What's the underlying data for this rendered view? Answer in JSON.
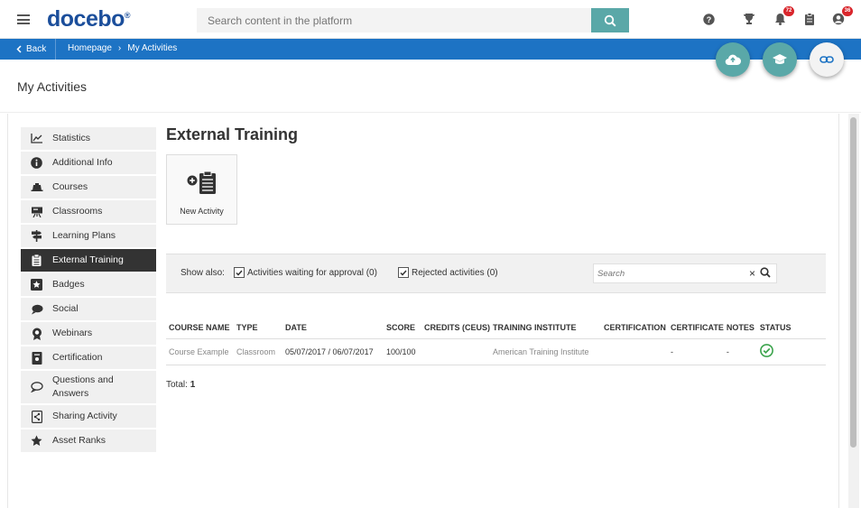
{
  "header": {
    "logo": "docebo",
    "logo_mark": "®",
    "search_placeholder": "Search content in the platform",
    "notifications_count": "72",
    "profile_count": "36"
  },
  "breadcrumb": {
    "back_label": "Back",
    "items": [
      "Homepage",
      "My Activities"
    ]
  },
  "page": {
    "title": "My Activities"
  },
  "sidebar": {
    "items": [
      {
        "label": "Statistics",
        "icon": "chart-icon"
      },
      {
        "label": "Additional Info",
        "icon": "info-icon"
      },
      {
        "label": "Courses",
        "icon": "courses-icon"
      },
      {
        "label": "Classrooms",
        "icon": "classroom-icon"
      },
      {
        "label": "Learning Plans",
        "icon": "signpost-icon"
      },
      {
        "label": "External Training",
        "icon": "clipboard-icon"
      },
      {
        "label": "Badges",
        "icon": "star-badge-icon"
      },
      {
        "label": "Social",
        "icon": "chat-icon"
      },
      {
        "label": "Webinars",
        "icon": "webinar-icon"
      },
      {
        "label": "Certification",
        "icon": "certificate-icon"
      },
      {
        "label": "Questions and Answers",
        "icon": "question-chat-icon"
      },
      {
        "label": "Sharing Activity",
        "icon": "share-icon"
      },
      {
        "label": "Asset Ranks",
        "icon": "star-icon"
      }
    ],
    "active_index": 5
  },
  "main": {
    "title": "External Training",
    "new_activity_label": "New Activity",
    "filter": {
      "show_also": "Show also:",
      "waiting_label": "Activities waiting for approval (0)",
      "rejected_label": "Rejected activities (0)",
      "search_placeholder": "Search"
    },
    "table": {
      "columns": [
        "COURSE NAME",
        "TYPE",
        "DATE",
        "SCORE",
        "CREDITS (CEUS)",
        "TRAINING INSTITUTE",
        "CERTIFICATION",
        "CERTIFICATE",
        "NOTES",
        "STATUS"
      ],
      "rows": [
        {
          "course_name": "Course Example",
          "type": "Classroom",
          "date": "05/07/2017 / 06/07/2017",
          "score": "100/100",
          "credits": "",
          "institute": "American Training Institute",
          "certification": "",
          "certificate": "-",
          "notes": "-",
          "status": "completed"
        }
      ]
    },
    "total_label": "Total:",
    "total_value": "1"
  },
  "colors": {
    "brand_blue": "#1b4e9b",
    "bar_blue": "#1d73c4",
    "teal": "#5aa8a8",
    "green_status": "#3aa34b",
    "badge_red": "#d9262c"
  }
}
